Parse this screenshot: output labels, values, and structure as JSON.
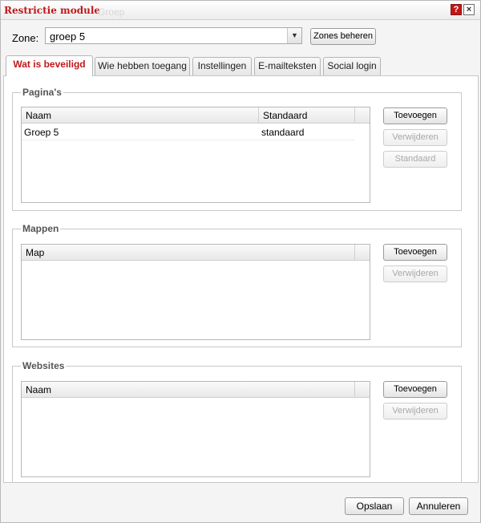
{
  "window": {
    "title": "Restrictie module",
    "background_title": "Groep",
    "help_glyph": "?",
    "close_glyph": "×"
  },
  "zone": {
    "label": "Zone:",
    "selected": "groep 5",
    "manage_button": "Zones beheren"
  },
  "tabs": [
    {
      "label": "Wat is beveiligd",
      "active": true
    },
    {
      "label": "Wie hebben toegang",
      "active": false
    },
    {
      "label": "Instellingen",
      "active": false
    },
    {
      "label": "E-mailteksten",
      "active": false
    },
    {
      "label": "Social login",
      "active": false
    }
  ],
  "pages_section": {
    "title": "Pagina's",
    "columns": [
      "Naam",
      "Standaard"
    ],
    "rows": [
      {
        "naam": "Groep 5",
        "standaard": "standaard"
      }
    ],
    "add_button": "Toevoegen",
    "remove_button": "Verwijderen",
    "default_button": "Standaard"
  },
  "folders_section": {
    "title": "Mappen",
    "columns": [
      "Map"
    ],
    "add_button": "Toevoegen",
    "remove_button": "Verwijderen"
  },
  "websites_section": {
    "title": "Websites",
    "columns": [
      "Naam"
    ],
    "add_button": "Toevoegen",
    "remove_button": "Verwijderen"
  },
  "footer": {
    "save_button": "Opslaan",
    "cancel_button": "Annuleren"
  },
  "colors": {
    "accent": "#c01818",
    "panel_background": "#f4f4f4"
  }
}
